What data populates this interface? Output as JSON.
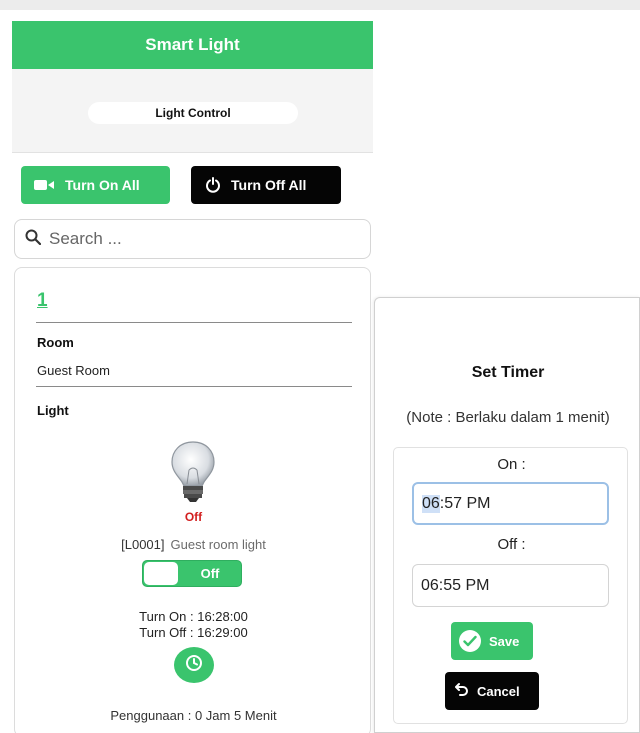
{
  "app": {
    "title": "Smart Light",
    "section_label": "Light Control"
  },
  "actions": {
    "turn_on_all": "Turn On All",
    "turn_off_all": "Turn Off All"
  },
  "search": {
    "placeholder": "Search ..."
  },
  "card": {
    "number": "1",
    "room_label": "Room",
    "room_value": "Guest Room",
    "light_label": "Light",
    "status": "Off",
    "light_id": "[L0001]",
    "light_name": "Guest room light",
    "toggle_label": "Off",
    "turn_on_time": "Turn On : 16:28:00",
    "turn_off_time": "Turn Off : 16:29:00",
    "usage": "Penggunaan : 0 Jam 5 Menit"
  },
  "timer_modal": {
    "title": "Set Timer",
    "note": "(Note : Berlaku dalam 1 menit)",
    "on_label": "On :",
    "on_value_hour": "06",
    "on_value_rest": ":57 PM",
    "off_label": "Off :",
    "off_value": "06:55 PM",
    "save_label": "Save",
    "cancel_label": "Cancel"
  },
  "colors": {
    "accent": "#3ac46d",
    "dark_button": "#050505",
    "status_off": "#d21f1f"
  },
  "icons": {
    "turn_on_all": "video-camera-icon",
    "turn_off_all": "power-icon",
    "search": "search-icon",
    "bulb": "light-bulb-icon",
    "timer": "clock-icon",
    "save": "check-circle-icon",
    "cancel": "undo-arrow-icon"
  }
}
